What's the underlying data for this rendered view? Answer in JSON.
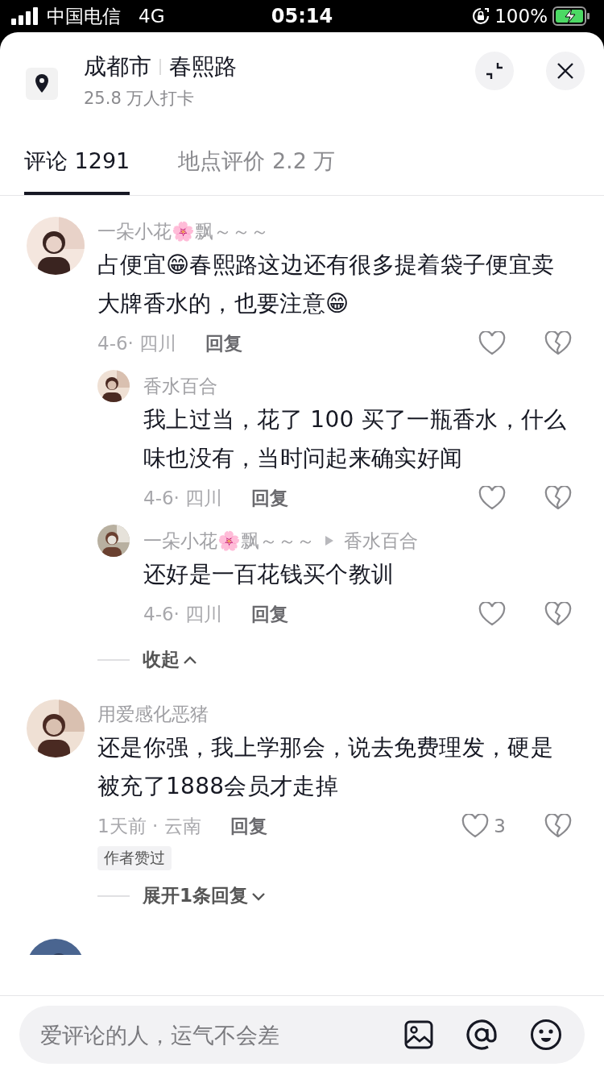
{
  "status_bar": {
    "carrier": "中国电信",
    "network": "4G",
    "time": "05:14",
    "battery": "100%"
  },
  "header": {
    "city": "成都市",
    "place": "春熙路",
    "checkins": "25.8 万人打卡"
  },
  "tabs": [
    {
      "label": "评论 1291",
      "selected": true
    },
    {
      "label": "地点评价 2.2 万",
      "selected": false
    }
  ],
  "comments": [
    {
      "name": "一朵小花🌸飘～～～",
      "text": "占便宜😁春熙路这边还有很多提着袋子便宜卖大牌香水的，也要注意😁",
      "meta": "4-6· 四川",
      "reply": "回复",
      "author_liked": false,
      "replies": [
        {
          "name": "香水百合",
          "text": "我上过当，花了 100 买了一瓶香水，什么味也没有，当时问起来确实好闻",
          "meta": "4-6· 四川",
          "reply": "回复"
        },
        {
          "name": "一朵小花🌸飘～～～",
          "reply_to": "香水百合",
          "text": "还好是一百花钱买个教训",
          "meta": "4-6· 四川",
          "reply": "回复"
        }
      ],
      "toggle": {
        "label": "收起",
        "expanded": true
      }
    },
    {
      "name": "用爱感化恶猪",
      "text": "还是你强，我上学那会，说去免费理发，硬是被充了1888会员才走掉",
      "meta": "1天前 · 云南",
      "reply": "回复",
      "likes": "3",
      "author_liked": true,
      "badge": "作者赞过",
      "toggle": {
        "label": "展开1条回复",
        "expanded": false
      }
    },
    {
      "kind": "picture"
    }
  ],
  "input": {
    "placeholder": "爱评论的人，运气不会差"
  }
}
